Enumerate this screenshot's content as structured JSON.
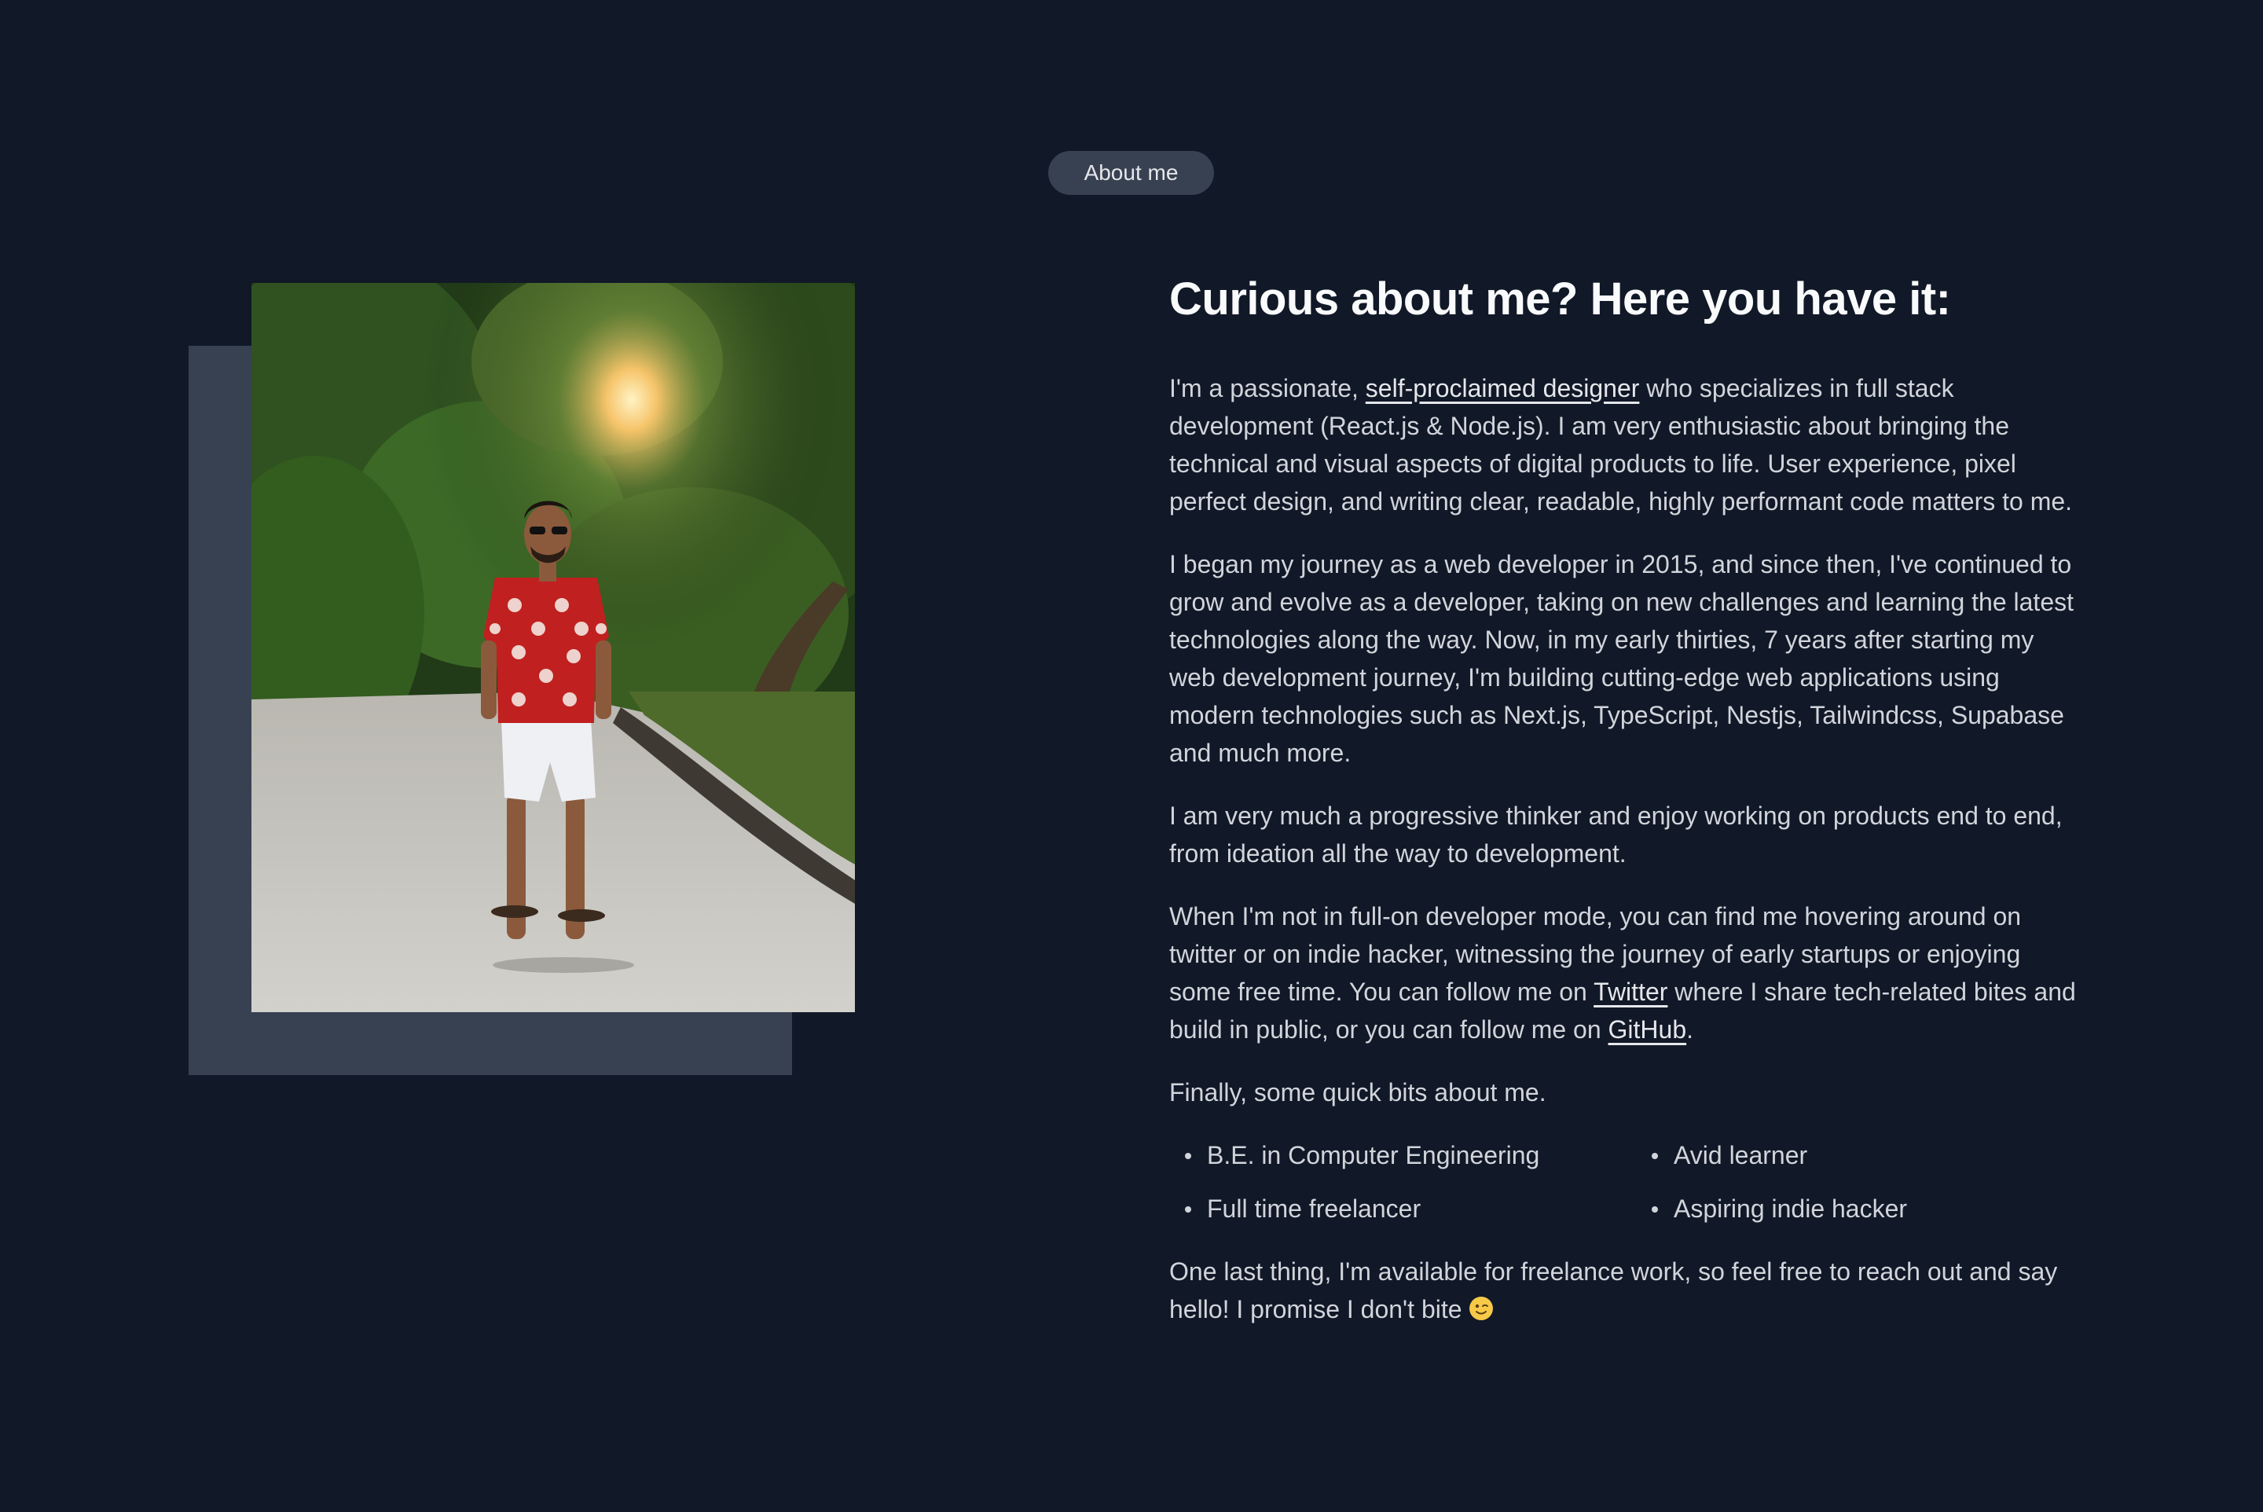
{
  "badge": {
    "label": "About me"
  },
  "heading": "Curious about me? Here you have it:",
  "paragraphs": {
    "p1": {
      "before": "I'm a passionate, ",
      "link": "self-proclaimed designer",
      "after": " who specializes in full stack development (React.js & Node.js). I am very enthusiastic about bringing the technical and visual aspects of digital products to life. User experience, pixel perfect design, and writing clear, readable, highly performant code matters to me."
    },
    "p2": "I began my journey as a web developer in 2015, and since then, I've continued to grow and evolve as a developer, taking on new challenges and learning the latest technologies along the way. Now, in my early thirties, 7 years after starting my web development journey, I'm building cutting-edge web applications using modern technologies such as Next.js, TypeScript, Nestjs, Tailwindcss, Supabase and much more.",
    "p3": "I am very much a progressive thinker and enjoy working on products end to end, from ideation all the way to development.",
    "p4": {
      "before": "When I'm not in full-on developer mode, you can find me hovering around on twitter or on indie hacker, witnessing the journey of early startups or enjoying some free time. You can follow me on ",
      "twitter": "Twitter",
      "middle": " where I share tech-related bites and build in public, or you can follow me on ",
      "github": "GitHub",
      "after": "."
    },
    "p5": "Finally, some quick bits about me.",
    "p6": "One last thing, I'm available for freelance work, so feel free to reach out and say hello! I promise I don't bite"
  },
  "bits": [
    "B.E. in Computer Engineering",
    "Avid learner",
    "Full time freelancer",
    "Aspiring indie hacker"
  ],
  "photo": {
    "icon": "profile-photo"
  },
  "colors": {
    "background": "#111827",
    "frame": "#374151",
    "badge": "#374151",
    "heading": "#f9fafb",
    "text": "#d1d5db"
  }
}
